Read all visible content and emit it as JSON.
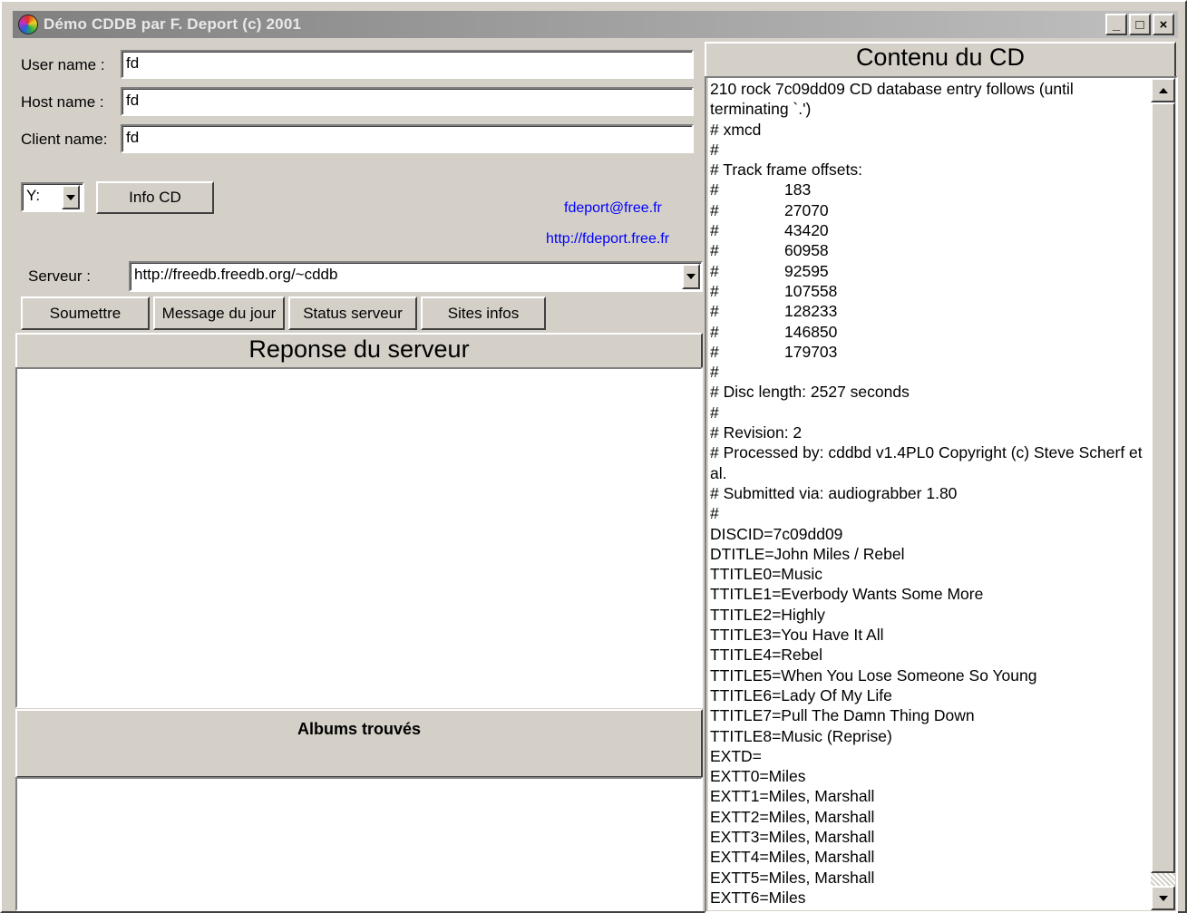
{
  "window": {
    "title": "Démo CDDB par F. Deport (c) 2001",
    "buttons": {
      "minimize": "_",
      "maximize": "□",
      "close": "×"
    }
  },
  "form": {
    "user_label": "User name :",
    "user_value": "fd",
    "host_label": "Host name :",
    "host_value": "fd",
    "client_label": "Client name:",
    "client_value": "fd",
    "drive_value": "Y:",
    "info_cd_button": "Info CD",
    "email_link": "fdeport@free.fr",
    "site_link": "http://fdeport.free.fr",
    "server_label": "Serveur :",
    "server_value": "http://freedb.freedb.org/~cddb"
  },
  "actions": {
    "submit": "Soumettre",
    "motd": "Message du jour",
    "status": "Status serveur",
    "sites": "Sites infos"
  },
  "response": {
    "title": "Reponse du serveur"
  },
  "albums": {
    "title": "Albums trouvés"
  },
  "cd_content": {
    "title": "Contenu du CD",
    "lines": [
      "210 rock 7c09dd09 CD database entry follows (until terminating `.')",
      "# xmcd",
      "#",
      "# Track frame offsets:",
      "#\t183",
      "#\t27070",
      "#\t43420",
      "#\t60958",
      "#\t92595",
      "#\t107558",
      "#\t128233",
      "#\t146850",
      "#\t179703",
      "#",
      "# Disc length: 2527 seconds",
      "#",
      "# Revision: 2",
      "# Processed by: cddbd v1.4PL0 Copyright (c) Steve Scherf et al.",
      "# Submitted via: audiograbber 1.80",
      "#",
      "DISCID=7c09dd09",
      "DTITLE=John Miles / Rebel",
      "TTITLE0=Music",
      "TTITLE1=Everbody Wants Some More",
      "TTITLE2=Highly",
      "TTITLE3=You Have It All",
      "TTITLE4=Rebel",
      "TTITLE5=When You Lose Someone So Young",
      "TTITLE6=Lady Of My Life",
      "TTITLE7=Pull The Damn Thing Down",
      "TTITLE8=Music (Reprise)",
      "EXTD=",
      "EXTT0=Miles",
      "EXTT1=Miles, Marshall",
      "EXTT2=Miles, Marshall",
      "EXTT3=Miles, Marshall",
      "EXTT4=Miles, Marshall",
      "EXTT5=Miles, Marshall",
      "EXTT6=Miles"
    ]
  }
}
